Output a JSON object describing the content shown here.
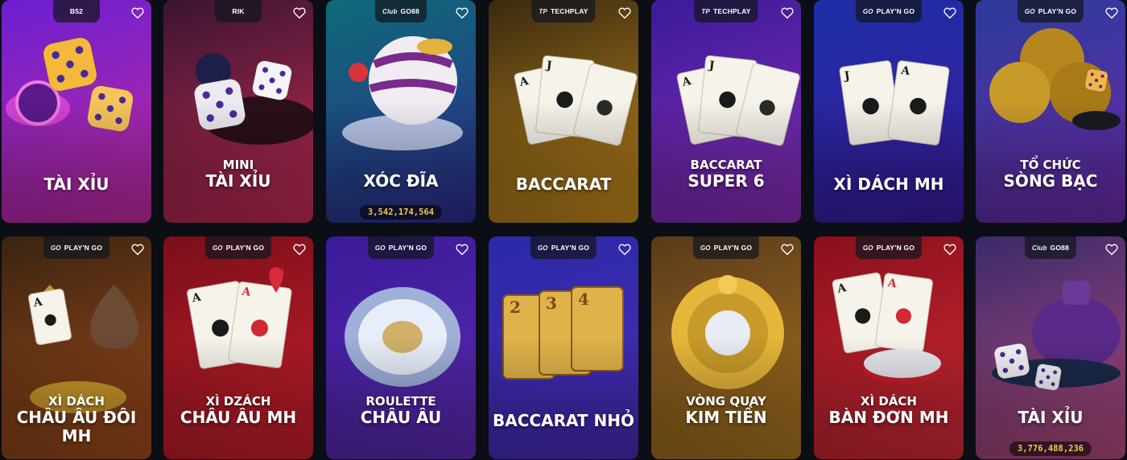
{
  "accent_jackpot_color": "#f5c84a",
  "cards": [
    {
      "provider": "B52",
      "provider_logo": "B52",
      "title_lines": [
        "TÀI XỈU"
      ],
      "jackpot": "",
      "bg": [
        "#6b1fd1",
        "#c22a9e"
      ],
      "art": "dice-and-chip"
    },
    {
      "provider": "RIK",
      "provider_logo": "RIK",
      "title_lines": [
        "MINI",
        "TÀI XỈU"
      ],
      "jackpot": "",
      "bg": [
        "#3a1530",
        "#c52a55"
      ],
      "art": "dice-pair"
    },
    {
      "provider": "GO88",
      "provider_logo": "Club",
      "title_lines": [
        "XÓC ĐĨA"
      ],
      "jackpot": "3,542,174,564",
      "bg": [
        "#0d6b78",
        "#2f2a8d"
      ],
      "art": "shaker-bowl"
    },
    {
      "provider": "TECHPLAY",
      "provider_logo": "TP",
      "title_lines": [
        "BACCARAT"
      ],
      "jackpot": "",
      "bg": [
        "#3a2a10",
        "#c48a1c"
      ],
      "art": "playing-cards"
    },
    {
      "provider": "TECHPLAY",
      "provider_logo": "TP",
      "title_lines": [
        "BACCARAT",
        "SUPER 6"
      ],
      "jackpot": "",
      "bg": [
        "#3a1b9a",
        "#8a2db5"
      ],
      "art": "playing-cards"
    },
    {
      "provider": "PLAY'N GO",
      "provider_logo": "GO",
      "title_lines": [
        "XÌ DÁCH MH"
      ],
      "jackpot": "",
      "bg": [
        "#1d2fa6",
        "#3a1a9c"
      ],
      "art": "jack-ace"
    },
    {
      "provider": "PLAY'N GO",
      "provider_logo": "GO",
      "title_lines": [
        "TỔ CHỨC",
        "SÒNG BẠC"
      ],
      "jackpot": "",
      "bg": [
        "#2b3b9a",
        "#6b2aa8"
      ],
      "art": "gold-club"
    },
    {
      "provider": "PLAY'N GO",
      "provider_logo": "GO",
      "title_lines": [
        "XÌ DÁCH",
        "CHÂU ÂU ĐÔI MH"
      ],
      "jackpot": "",
      "bg": [
        "#3a2410",
        "#a04a1c"
      ],
      "art": "spades"
    },
    {
      "provider": "PLAY'N GO",
      "provider_logo": "GO",
      "title_lines": [
        "XÌ DZÁCH",
        "CHÂU ÂU MH"
      ],
      "jackpot": "",
      "bg": [
        "#7a0f1a",
        "#c81f2c"
      ],
      "art": "aces-red"
    },
    {
      "provider": "PLAY'N GO",
      "provider_logo": "GO",
      "title_lines": [
        "ROULETTE",
        "CHÂU ÂU"
      ],
      "jackpot": "",
      "bg": [
        "#3a1b9a",
        "#5b2ab0"
      ],
      "art": "roulette"
    },
    {
      "provider": "PLAY'N GO",
      "provider_logo": "GO",
      "title_lines": [
        "BACCARAT NHỎ"
      ],
      "jackpot": "",
      "bg": [
        "#2a2aa8",
        "#4b2ab5"
      ],
      "art": "gold-cards"
    },
    {
      "provider": "PLAY'N GO",
      "provider_logo": "GO",
      "title_lines": [
        "VÒNG QUAY",
        "KIM TIỀN"
      ],
      "jackpot": "",
      "bg": [
        "#5a3a1a",
        "#a8741f"
      ],
      "art": "gold-wheel"
    },
    {
      "provider": "PLAY'N GO",
      "provider_logo": "GO",
      "title_lines": [
        "XÌ DÁCH",
        "BÀN ĐƠN MH"
      ],
      "jackpot": "",
      "bg": [
        "#8a0f1c",
        "#d02a36"
      ],
      "art": "ace-chips"
    },
    {
      "provider": "GO88",
      "provider_logo": "Club",
      "title_lines": [
        "TÀI XỈU"
      ],
      "jackpot": "3,776,488,236",
      "bg": [
        "#3a2a6a",
        "#b24a7a"
      ],
      "art": "dice-shaker"
    }
  ]
}
